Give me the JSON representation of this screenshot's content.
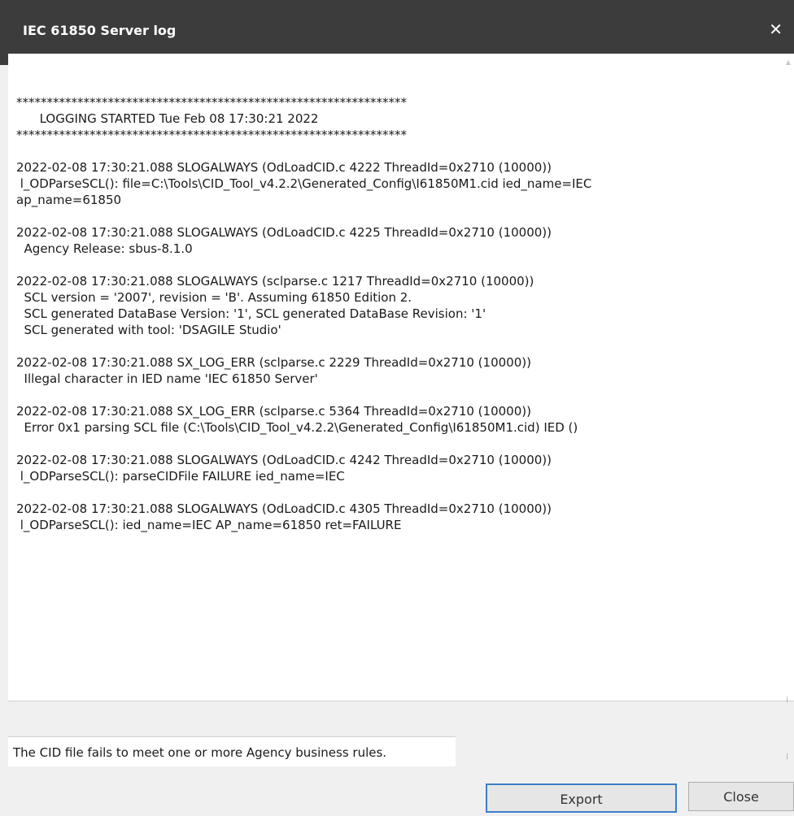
{
  "window": {
    "title": "IEC 61850 Server log",
    "close_glyph": "✕"
  },
  "log": {
    "banner_stars": "****************************************************************",
    "banner_text": "      LOGGING STARTED Tue Feb 08 17:30:21 2022",
    "entries": [
      {
        "lines": [
          "2022-02-08 17:30:21.088 SLOGALWAYS (OdLoadCID.c 4222 ThreadId=0x2710 (10000))",
          " l_ODParseSCL(): file=C:\\Tools\\CID_Tool_v4.2.2\\Generated_Config\\I61850M1.cid ied_name=IEC",
          "ap_name=61850"
        ]
      },
      {
        "lines": [
          "2022-02-08 17:30:21.088 SLOGALWAYS (OdLoadCID.c 4225 ThreadId=0x2710 (10000))",
          "  Agency Release: sbus-8.1.0"
        ]
      },
      {
        "lines": [
          "2022-02-08 17:30:21.088 SLOGALWAYS (sclparse.c 1217 ThreadId=0x2710 (10000))",
          "  SCL version = '2007', revision = 'B'. Assuming 61850 Edition 2.",
          "  SCL generated DataBase Version: '1', SCL generated DataBase Revision: '1'",
          "  SCL generated with tool: 'DSAGILE Studio'"
        ]
      },
      {
        "lines": [
          "2022-02-08 17:30:21.088 SX_LOG_ERR (sclparse.c 2229 ThreadId=0x2710 (10000))",
          "  Illegal character in IED name 'IEC 61850 Server'"
        ]
      },
      {
        "lines": [
          "2022-02-08 17:30:21.088 SX_LOG_ERR (sclparse.c 5364 ThreadId=0x2710 (10000))",
          "  Error 0x1 parsing SCL file (C:\\Tools\\CID_Tool_v4.2.2\\Generated_Config\\I61850M1.cid) IED ()"
        ]
      },
      {
        "lines": [
          "2022-02-08 17:30:21.088 SLOGALWAYS (OdLoadCID.c 4242 ThreadId=0x2710 (10000))",
          " l_ODParseSCL(): parseCIDFile FAILURE ied_name=IEC"
        ]
      },
      {
        "lines": [
          "2022-02-08 17:30:21.088 SLOGALWAYS (OdLoadCID.c 4305 ThreadId=0x2710 (10000))",
          " l_ODParseSCL(): ied_name=IEC AP_name=61850 ret=FAILURE"
        ]
      }
    ]
  },
  "status": {
    "message": "The CID file fails to meet one or more Agency business rules."
  },
  "buttons": {
    "export_label": "Export",
    "close_label": "Close"
  },
  "colors": {
    "titlebar_bg": "#3c3c3c",
    "focus_border": "#3c7fc8"
  }
}
